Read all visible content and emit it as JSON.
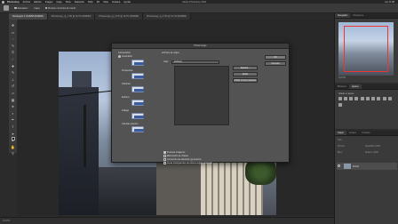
{
  "menubar": {
    "items": [
      "Photoshop",
      "Archivo",
      "Edición",
      "Imagen",
      "Capa",
      "Texto",
      "Selección",
      "Filtro",
      "3D",
      "Vista",
      "Ventana",
      "Ayuda"
    ],
    "window_title": "Adobe Photoshop 2020",
    "clock": "lun 17:28"
  },
  "optbar": {
    "options": [
      "Autoselec.:",
      "Capa",
      "Mostrar controles de transf."
    ]
  },
  "tabs": [
    {
      "label": "Rectángulo 3, RGB/8# (RGB/8#)",
      "active": true
    },
    {
      "label": "Photomerge_rg_1.TIF @ 16,7% (RGB/8#)",
      "active": false
    },
    {
      "label": "Photomerge_rg_2.TIF @ 16,7% (RGB/8#)",
      "active": false
    },
    {
      "label": "Photomerge_rg_3.TIF @ 16,7% (RGB/8#)",
      "active": false
    }
  ],
  "toolbar": {
    "tools": [
      "move-tool",
      "marquee-tool",
      "lasso-tool",
      "quick-select-tool",
      "crop-tool",
      "eyedropper-tool",
      "healing-tool",
      "brush-tool",
      "stamp-tool",
      "history-brush-tool",
      "eraser-tool",
      "gradient-tool",
      "blur-tool",
      "dodge-tool",
      "pen-tool",
      "type-tool",
      "path-select-tool",
      "shape-tool",
      "hand-tool",
      "zoom-tool"
    ]
  },
  "statusbar": {
    "text": "16,67%"
  },
  "dialog": {
    "title": "Photomerge",
    "layout_title": "Composición",
    "layouts": [
      {
        "label": "Automático",
        "selected": true
      },
      {
        "label": "Perspectiva",
        "selected": false
      },
      {
        "label": "Cilíndrico",
        "selected": false
      },
      {
        "label": "Esférico",
        "selected": false
      },
      {
        "label": "Collage",
        "selected": false
      },
      {
        "label": "Cambiar posición",
        "selected": false
      }
    ],
    "source_title": "Archivos de origen",
    "use_label": "Usar:",
    "use_value": "Archivos",
    "browse_button": "Explorar...",
    "remove_button": "Quitar",
    "add_open_button": "Añadir archivos abiertos",
    "ok_button": "OK",
    "cancel_button": "Cancelar",
    "options": [
      {
        "label": "Fusionar imágenes",
        "checked": true
      },
      {
        "label": "Eliminación de viñetas",
        "checked": false
      },
      {
        "label": "Corrección de distorsión geométrica",
        "checked": false
      },
      {
        "label": "Áreas transparentes de relleno según contenido",
        "checked": false
      }
    ]
  },
  "panels": {
    "nav_tabs": [
      "Navegador",
      "Histograma"
    ],
    "nav_zoom": "16,67%",
    "adj_tabs": [
      "Biblioteca",
      "Ajustes"
    ],
    "adj_title": "Añadir un ajuste",
    "layers_tabs": [
      "Capas",
      "Canales",
      "Trazados"
    ],
    "layer_kind": "Tipo",
    "layer_mode": "Normal",
    "layer_opacity": "Opacidad: 100%",
    "layer_lock": "Bloq.:",
    "layer_fill": "Relleno: 100%",
    "layer_name": "Fondo"
  }
}
